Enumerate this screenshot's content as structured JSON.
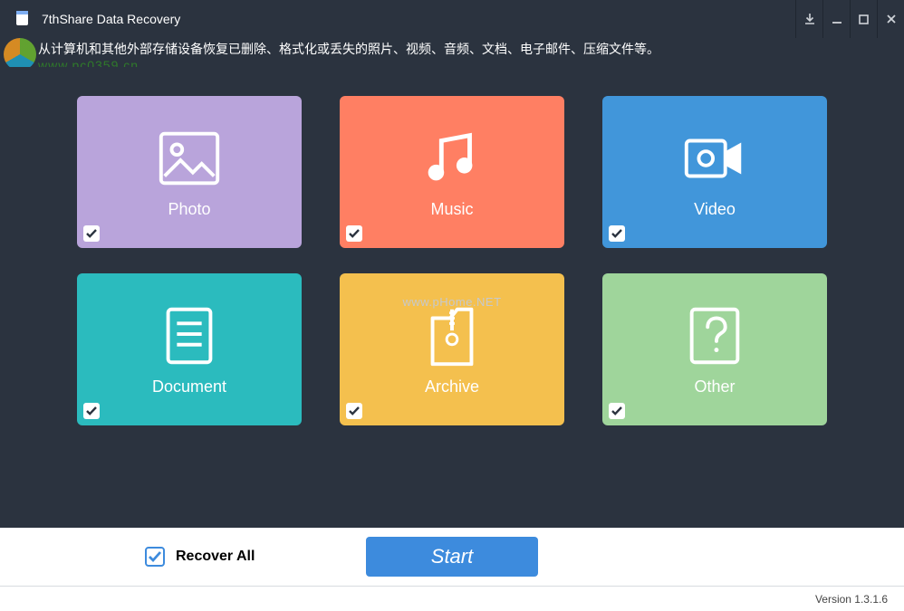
{
  "app": {
    "title": "7thShare Data Recovery",
    "description": "从计算机和其他外部存储设备恢复已删除、格式化或丢失的照片、视频、音频、文档、电子邮件、压缩文件等。"
  },
  "watermarks": {
    "site1": "www.pc0359.cn",
    "site2": "www.pHome.NET"
  },
  "tiles": [
    {
      "id": "photo",
      "label": "Photo",
      "checked": true,
      "color": "#b9a4db"
    },
    {
      "id": "music",
      "label": "Music",
      "checked": true,
      "color": "#ff7f63"
    },
    {
      "id": "video",
      "label": "Video",
      "checked": true,
      "color": "#4196da"
    },
    {
      "id": "document",
      "label": "Document",
      "checked": true,
      "color": "#2bbbbe"
    },
    {
      "id": "archive",
      "label": "Archive",
      "checked": true,
      "color": "#f4c04e"
    },
    {
      "id": "other",
      "label": "Other",
      "checked": true,
      "color": "#9fd59b"
    }
  ],
  "recoverAll": {
    "label": "Recover All",
    "checked": true
  },
  "buttons": {
    "start": "Start"
  },
  "footer": {
    "version": "Version 1.3.1.6"
  }
}
